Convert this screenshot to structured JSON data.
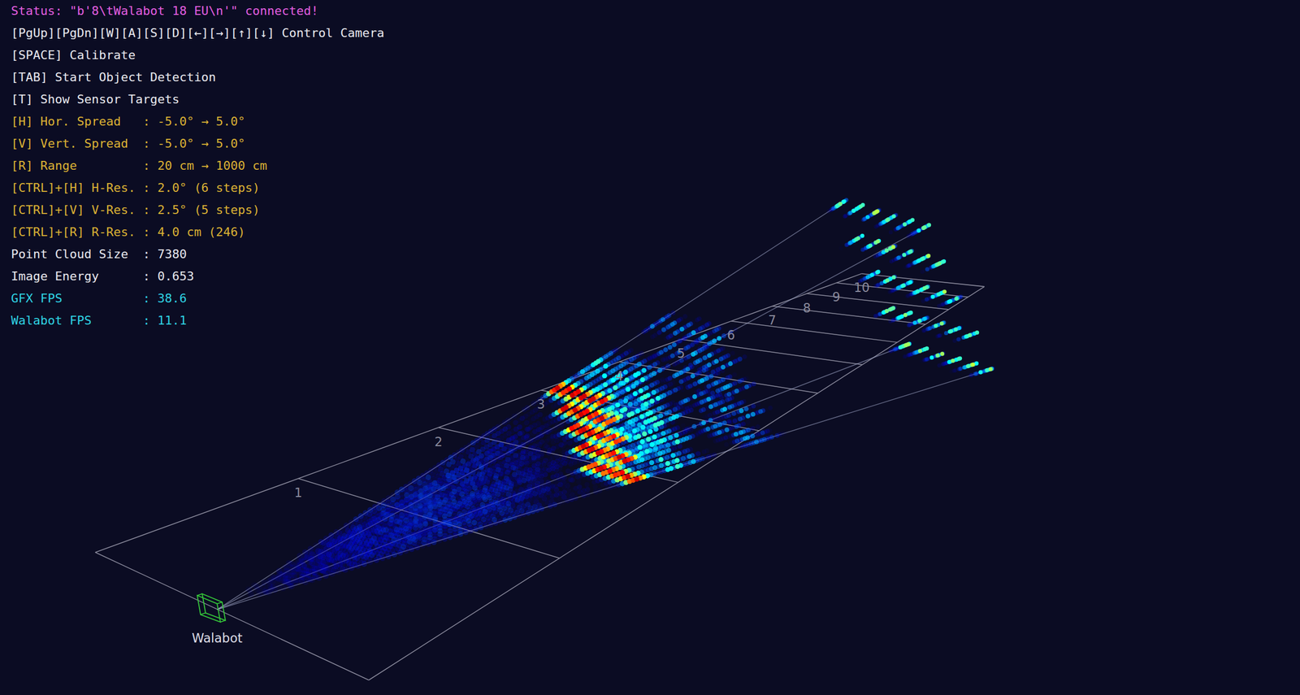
{
  "info_lines": [
    {
      "text": "Status: \"b'8\\tWalabot 18 EU\\n'\" connected!",
      "color": "#e25ee0"
    },
    {
      "text": "[PgUp][PgDn][W][A][S][D][←][→][↑][↓] Control Camera",
      "color": "#e8e8ee"
    },
    {
      "text": "[SPACE] Calibrate",
      "color": "#e8e8ee"
    },
    {
      "text": "[TAB] Start Object Detection",
      "color": "#e8e8ee"
    },
    {
      "text": "[T] Show Sensor Targets",
      "color": "#e8e8ee"
    },
    {
      "text": "[H] Hor. Spread   : -5.0° → 5.0°",
      "color": "#dcb234"
    },
    {
      "text": "[V] Vert. Spread  : -5.0° → 5.0°",
      "color": "#dcb234"
    },
    {
      "text": "[R] Range         : 20 cm → 1000 cm",
      "color": "#dcb234"
    },
    {
      "text": "[CTRL]+[H] H-Res. : 2.0° (6 steps)",
      "color": "#dcb234"
    },
    {
      "text": "[CTRL]+[V] V-Res. : 2.5° (5 steps)",
      "color": "#dcb234"
    },
    {
      "text": "[CTRL]+[R] R-Res. : 4.0 cm (246)",
      "color": "#dcb234"
    },
    {
      "text": "Point Cloud Size  : 7380",
      "color": "#e8e8ee"
    },
    {
      "text": "Image Energy      : 0.653",
      "color": "#e8e8ee"
    },
    {
      "text": "GFX FPS           : 38.6",
      "color": "#2fd3e3"
    },
    {
      "text": "Walabot FPS       : 11.1",
      "color": "#2fd3e3"
    }
  ],
  "scene": {
    "range_labels": [
      "1",
      "2",
      "3",
      "4",
      "5",
      "6",
      "7",
      "8",
      "9",
      "10"
    ],
    "sensor": {
      "label": "Walabot"
    }
  },
  "point_cloud": {
    "range_min_m": 0.2,
    "range_step_m": 0.04,
    "range_steps": 246,
    "az_min_deg": -5,
    "az_step_deg": 2,
    "az_steps": 6,
    "el_min_deg": -5,
    "el_step_deg": 2.5,
    "el_steps": 5,
    "returns": [
      {
        "range_m": 3.15,
        "width_m": 0.13,
        "intensity": 1.0,
        "sparsity": 0.25
      },
      {
        "range_m": 1.6,
        "width_m": 1.5,
        "intensity": 0.2,
        "sparsity": 0.5
      },
      {
        "range_m": 3.7,
        "width_m": 0.35,
        "intensity": 0.45,
        "sparsity": 0.6
      },
      {
        "range_m": 4.8,
        "width_m": 0.3,
        "intensity": 0.35,
        "sparsity": 0.7
      },
      {
        "range_m": 9.9,
        "width_m": 0.5,
        "intensity": 0.6,
        "sparsity": 0.85
      }
    ]
  }
}
